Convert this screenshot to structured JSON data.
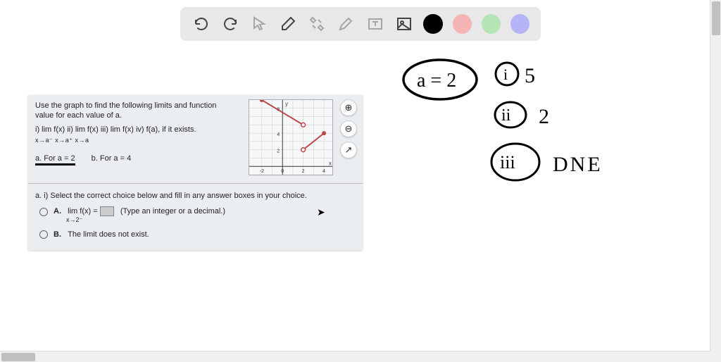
{
  "toolbar": {
    "tools": [
      "undo",
      "redo",
      "pointer",
      "eraser",
      "settings",
      "highlight",
      "textbox",
      "image"
    ],
    "colors": [
      "#000000",
      "#f5b5b5",
      "#b5e5b5",
      "#b5b5f5"
    ]
  },
  "problem": {
    "intro": "Use the graph to find the following limits and function value for each value of a.",
    "items_label": "i)  lim f(x)  ii)  lim f(x)  iii)  lim f(x)  iv) f(a), if it exists.",
    "items_sub": "x→a⁻            x→a⁺            x→a",
    "part_a_label": "a.  For a = 2",
    "part_b_label": "b.  For a = 4",
    "question_label": "a.  i)  Select the correct choice below and fill in any answer boxes in your choice.",
    "choice_a_prefix": "A.",
    "choice_a_text1": "lim f(x) =",
    "choice_a_text2": "(Type an integer or a decimal.)",
    "choice_a_sub": "x→2⁻",
    "choice_b_prefix": "B.",
    "choice_b_text": "The limit does not exist."
  },
  "graph_buttons": {
    "zoom_in": "⊕",
    "zoom_out": "⊖",
    "popout": "↗"
  },
  "chart_data": {
    "type": "line",
    "title": "",
    "xlabel": "x",
    "ylabel": "y",
    "xlim": [
      -3,
      5
    ],
    "ylim": [
      -1,
      9
    ],
    "xticks": [
      -2,
      0,
      2,
      4
    ],
    "yticks": [
      2,
      4,
      6,
      8
    ],
    "series": [
      {
        "name": "segment1",
        "points": [
          [
            -2,
            8
          ],
          [
            2,
            5
          ]
        ],
        "endpoints": {
          "start": "closed",
          "end": "open"
        },
        "color": "#c44"
      },
      {
        "name": "segment2",
        "points": [
          [
            2,
            2
          ],
          [
            4,
            4
          ]
        ],
        "endpoints": {
          "start": "open",
          "end": "closed"
        },
        "color": "#c44"
      }
    ],
    "isolated_points": []
  },
  "handwriting": {
    "note1": "a = 2",
    "note2_num": "i",
    "note2_val": "5",
    "note3_num": "ii",
    "note3_val": "2",
    "note4_num": "iii",
    "note4_val": "DNE"
  }
}
